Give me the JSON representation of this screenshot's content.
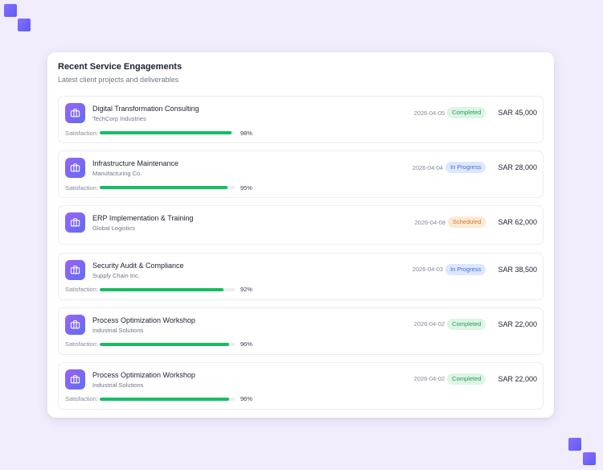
{
  "card": {
    "title": "Recent Service Engagements",
    "subtitle": "Latest client projects and deliverables"
  },
  "satisfaction_label": "Satisfaction:",
  "colors": {
    "completed": "#2a9b52",
    "in_progress": "#3d6ee3",
    "scheduled": "#d27a2c",
    "bar_fill": "#17bd62",
    "accent": "#7a67f4"
  },
  "engagements": [
    {
      "icon": "briefcase-icon",
      "title": "Digital Transformation Consulting",
      "client": "TechCorp Industries",
      "date": "2026-04-05",
      "status": "Completed",
      "status_kind": "completed",
      "amount": "SAR 45,000",
      "satisfaction": "98%",
      "satisfaction_value": 98
    },
    {
      "icon": "briefcase-icon",
      "title": "Infrastructure Maintenance",
      "client": "Manufacturing Co.",
      "date": "2026-04-04",
      "status": "In Progress",
      "status_kind": "progress",
      "amount": "SAR 28,000",
      "satisfaction": "95%",
      "satisfaction_value": 95
    },
    {
      "icon": "briefcase-icon",
      "title": "ERP Implementation & Training",
      "client": "Global Logistics",
      "date": "2026-04-08",
      "status": "Scheduled",
      "status_kind": "scheduled",
      "amount": "SAR 62,000",
      "satisfaction": null,
      "satisfaction_value": null
    },
    {
      "icon": "briefcase-icon",
      "title": "Security Audit & Compliance",
      "client": "Supply Chain Inc.",
      "date": "2026-04-03",
      "status": "In Progress",
      "status_kind": "progress",
      "amount": "SAR 38,500",
      "satisfaction": "92%",
      "satisfaction_value": 92
    },
    {
      "icon": "briefcase-icon",
      "title": "Process Optimization Workshop",
      "client": "Industrial Solutions",
      "date": "2026-04-02",
      "status": "Completed",
      "status_kind": "completed",
      "amount": "SAR 22,000",
      "satisfaction": "96%",
      "satisfaction_value": 96
    },
    {
      "icon": "briefcase-icon",
      "title": "Process Optimization Workshop",
      "client": "Industrial Solutions",
      "date": "2026-04-02",
      "status": "Completed",
      "status_kind": "completed",
      "amount": "SAR 22,000",
      "satisfaction": "96%",
      "satisfaction_value": 96
    }
  ]
}
